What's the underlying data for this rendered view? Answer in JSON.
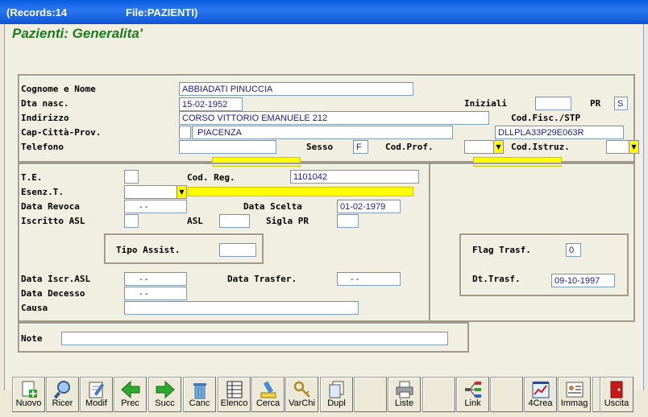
{
  "window": {
    "records": "(Records:14",
    "file": "File:PAZIENTI)"
  },
  "form_title": "Pazienti: Generalita'",
  "labels": {
    "cognome_nome": "Cognome e Nome",
    "dta_nasc": "Dta nasc.",
    "iniziali": "Iniziali",
    "pr": "PR",
    "indirizzo": "Indirizzo",
    "cod_fisc": "Cod.Fisc./STP",
    "cap_citta": "Cap-Città-Prov.",
    "telefono": "Telefono",
    "sesso": "Sesso",
    "cod_prof": "Cod.Prof.",
    "cod_istruz": "Cod.Istruz.",
    "te": "T.E.",
    "cod_reg": "Cod. Reg.",
    "esenz": "Esenz.T.",
    "data_revoca": "Data Revoca",
    "data_scelta": "Data Scelta",
    "iscritto_asl": "Iscritto ASL",
    "asl": "ASL",
    "sigla_pr": "Sigla PR",
    "tipo_assist": "Tipo Assist.",
    "data_iscr_asl": "Data Iscr.ASL",
    "data_trasfer": "Data Trasfer.",
    "data_decesso": "Data Decesso",
    "causa": "Causa",
    "note": "Note",
    "flag_trasf": "Flag Trasf.",
    "dt_trasf": "Dt.Trasf."
  },
  "values": {
    "cognome_nome": "ABBIADATI PINUCCIA",
    "dta_nasc": "15-02-1952",
    "iniziali": "",
    "pr": "S",
    "indirizzo": "CORSO VITTORIO EMANUELE 212",
    "cap": "",
    "citta": "PIACENZA",
    "cod_fisc": "DLLPLA33P29E063R",
    "telefono": "",
    "sesso": "F",
    "te": "",
    "cod_reg": "1101042",
    "data_revoca": "-  -",
    "data_scelta": "01-02-1979",
    "iscritto_asl": "",
    "asl": "",
    "sigla_pr": "",
    "tipo_assist": "",
    "data_iscr_asl": "-  -",
    "data_trasfer": "-  -",
    "data_decesso": "-  -",
    "causa": "",
    "note": "",
    "flag_trasf": "0",
    "dt_trasf": "09-10-1997"
  },
  "toolbar": [
    {
      "label": "Nuovo",
      "icon": "new-record-icon"
    },
    {
      "label": "Ricer",
      "icon": "search-icon"
    },
    {
      "label": "Modif",
      "icon": "edit-icon"
    },
    {
      "label": "Prec",
      "icon": "arrow-left-icon"
    },
    {
      "label": "Succ",
      "icon": "arrow-right-icon"
    },
    {
      "label": "Canc",
      "icon": "trash-icon"
    },
    {
      "label": "Elenco",
      "icon": "list-icon"
    },
    {
      "label": "Cerca",
      "icon": "find-icon"
    },
    {
      "label": "VarChi",
      "icon": "keys-icon"
    },
    {
      "label": "Dupl",
      "icon": "duplicate-icon"
    },
    {
      "label": "",
      "icon": ""
    },
    {
      "label": "Liste",
      "icon": "printer-icon"
    },
    {
      "label": "",
      "icon": ""
    },
    {
      "label": "Link",
      "icon": "link-icon"
    },
    {
      "label": "",
      "icon": ""
    },
    {
      "label": "4Crea",
      "icon": "create-icon"
    },
    {
      "label": "Immag",
      "icon": "image-icon"
    },
    {
      "label": "",
      "icon": ""
    },
    {
      "label": "Uscita",
      "icon": "exit-door-icon"
    }
  ]
}
